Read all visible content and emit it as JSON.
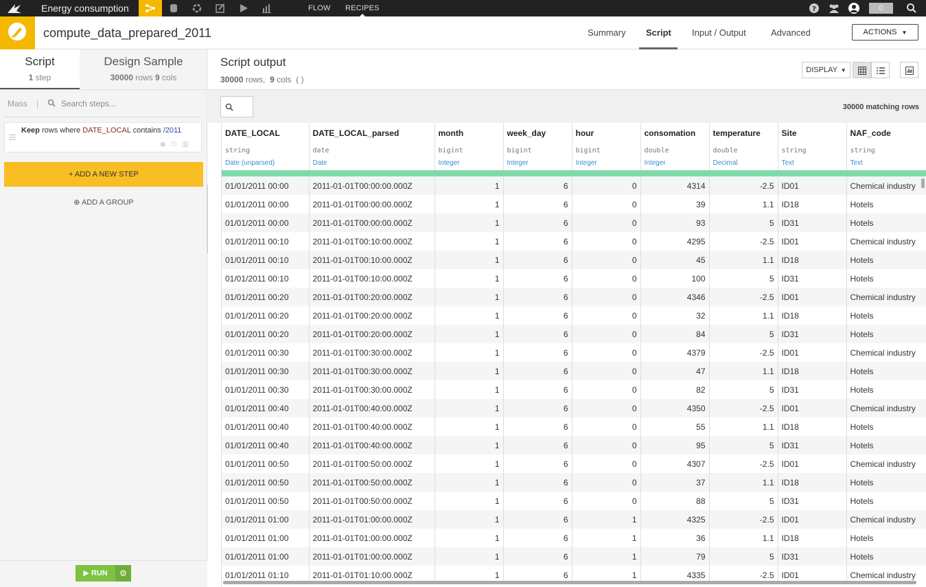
{
  "topbar": {
    "project_name": "Energy consumption",
    "nav": [
      "FLOW",
      "RECIPES"
    ],
    "counter": "0"
  },
  "header": {
    "recipe_name": "compute_data_prepared_2011",
    "tabs": [
      "Summary",
      "Script",
      "Input / Output",
      "Advanced"
    ],
    "actions_label": "ACTIONS"
  },
  "left": {
    "tab_script": {
      "title": "Script",
      "count": "1",
      "unit": "step"
    },
    "tab_sample": {
      "title": "Design Sample",
      "rows": "30000",
      "rows_unit": "rows",
      "cols": "9",
      "cols_unit": "cols"
    },
    "mass_label": "Mass",
    "search_placeholder": "Search steps...",
    "step": {
      "keyword": "Keep",
      "text1": "rows where",
      "column": "DATE_LOCAL",
      "text2": "contains",
      "value": "/2011"
    },
    "add_step_label": "+ ADD A NEW STEP",
    "add_group_label": "ADD A GROUP",
    "run_label": "RUN"
  },
  "output": {
    "title": "Script output",
    "rows": "30000",
    "rows_unit": "rows,",
    "cols": "9",
    "cols_unit": "cols",
    "paren": "( )",
    "display_label": "DISPLAY",
    "matching": "30000 matching rows"
  },
  "columns": [
    {
      "name": "DATE_LOCAL",
      "type": "string",
      "meaning": "Date (unparsed)",
      "align": "left",
      "width": 127
    },
    {
      "name": "DATE_LOCAL_parsed",
      "type": "date",
      "meaning": "Date",
      "align": "left",
      "width": 183
    },
    {
      "name": "month",
      "type": "bigint",
      "meaning": "Integer",
      "align": "right",
      "width": 100
    },
    {
      "name": "week_day",
      "type": "bigint",
      "meaning": "Integer",
      "align": "right",
      "width": 100
    },
    {
      "name": "hour",
      "type": "bigint",
      "meaning": "Integer",
      "align": "right",
      "width": 100
    },
    {
      "name": "consomation",
      "type": "double",
      "meaning": "Integer",
      "align": "right",
      "width": 100
    },
    {
      "name": "temperature",
      "type": "double",
      "meaning": "Decimal",
      "align": "right",
      "width": 100
    },
    {
      "name": "Site",
      "type": "string",
      "meaning": "Text",
      "align": "left",
      "width": 100
    },
    {
      "name": "NAF_code",
      "type": "string",
      "meaning": "Text",
      "align": "left",
      "width": 130
    }
  ],
  "rows": [
    [
      "01/01/2011 00:00",
      "2011-01-01T00:00:00.000Z",
      "1",
      "6",
      "0",
      "4314",
      "-2.5",
      "ID01",
      "Chemical industry"
    ],
    [
      "01/01/2011 00:00",
      "2011-01-01T00:00:00.000Z",
      "1",
      "6",
      "0",
      "39",
      "1.1",
      "ID18",
      "Hotels"
    ],
    [
      "01/01/2011 00:00",
      "2011-01-01T00:00:00.000Z",
      "1",
      "6",
      "0",
      "93",
      "5",
      "ID31",
      "Hotels"
    ],
    [
      "01/01/2011 00:10",
      "2011-01-01T00:10:00.000Z",
      "1",
      "6",
      "0",
      "4295",
      "-2.5",
      "ID01",
      "Chemical industry"
    ],
    [
      "01/01/2011 00:10",
      "2011-01-01T00:10:00.000Z",
      "1",
      "6",
      "0",
      "45",
      "1.1",
      "ID18",
      "Hotels"
    ],
    [
      "01/01/2011 00:10",
      "2011-01-01T00:10:00.000Z",
      "1",
      "6",
      "0",
      "100",
      "5",
      "ID31",
      "Hotels"
    ],
    [
      "01/01/2011 00:20",
      "2011-01-01T00:20:00.000Z",
      "1",
      "6",
      "0",
      "4346",
      "-2.5",
      "ID01",
      "Chemical industry"
    ],
    [
      "01/01/2011 00:20",
      "2011-01-01T00:20:00.000Z",
      "1",
      "6",
      "0",
      "32",
      "1.1",
      "ID18",
      "Hotels"
    ],
    [
      "01/01/2011 00:20",
      "2011-01-01T00:20:00.000Z",
      "1",
      "6",
      "0",
      "84",
      "5",
      "ID31",
      "Hotels"
    ],
    [
      "01/01/2011 00:30",
      "2011-01-01T00:30:00.000Z",
      "1",
      "6",
      "0",
      "4379",
      "-2.5",
      "ID01",
      "Chemical industry"
    ],
    [
      "01/01/2011 00:30",
      "2011-01-01T00:30:00.000Z",
      "1",
      "6",
      "0",
      "47",
      "1.1",
      "ID18",
      "Hotels"
    ],
    [
      "01/01/2011 00:30",
      "2011-01-01T00:30:00.000Z",
      "1",
      "6",
      "0",
      "82",
      "5",
      "ID31",
      "Hotels"
    ],
    [
      "01/01/2011 00:40",
      "2011-01-01T00:40:00.000Z",
      "1",
      "6",
      "0",
      "4350",
      "-2.5",
      "ID01",
      "Chemical industry"
    ],
    [
      "01/01/2011 00:40",
      "2011-01-01T00:40:00.000Z",
      "1",
      "6",
      "0",
      "55",
      "1.1",
      "ID18",
      "Hotels"
    ],
    [
      "01/01/2011 00:40",
      "2011-01-01T00:40:00.000Z",
      "1",
      "6",
      "0",
      "95",
      "5",
      "ID31",
      "Hotels"
    ],
    [
      "01/01/2011 00:50",
      "2011-01-01T00:50:00.000Z",
      "1",
      "6",
      "0",
      "4307",
      "-2.5",
      "ID01",
      "Chemical industry"
    ],
    [
      "01/01/2011 00:50",
      "2011-01-01T00:50:00.000Z",
      "1",
      "6",
      "0",
      "37",
      "1.1",
      "ID18",
      "Hotels"
    ],
    [
      "01/01/2011 00:50",
      "2011-01-01T00:50:00.000Z",
      "1",
      "6",
      "0",
      "88",
      "5",
      "ID31",
      "Hotels"
    ],
    [
      "01/01/2011 01:00",
      "2011-01-01T01:00:00.000Z",
      "1",
      "6",
      "1",
      "4325",
      "-2.5",
      "ID01",
      "Chemical industry"
    ],
    [
      "01/01/2011 01:00",
      "2011-01-01T01:00:00.000Z",
      "1",
      "6",
      "1",
      "36",
      "1.1",
      "ID18",
      "Hotels"
    ],
    [
      "01/01/2011 01:00",
      "2011-01-01T01:00:00.000Z",
      "1",
      "6",
      "1",
      "79",
      "5",
      "ID31",
      "Hotels"
    ],
    [
      "01/01/2011 01:10",
      "2011-01-01T01:10:00.000Z",
      "1",
      "6",
      "1",
      "4335",
      "-2.5",
      "ID01",
      "Chemical industry"
    ]
  ],
  "colors": {
    "accent": "#f5b800",
    "run": "#7dc242",
    "validity": "#7fd9a8",
    "meaning": "#3a8fd0"
  },
  "icons": {
    "top": [
      "dss-bird-logo",
      "flow-icon",
      "datasets-icon",
      "recipes-icon",
      "notebooks-icon",
      "jobs-icon",
      "dashboards-icon",
      "help-icon",
      "users-icon",
      "profile-icon",
      "search-icon"
    ],
    "recipe": "prepare-brush-icon"
  }
}
